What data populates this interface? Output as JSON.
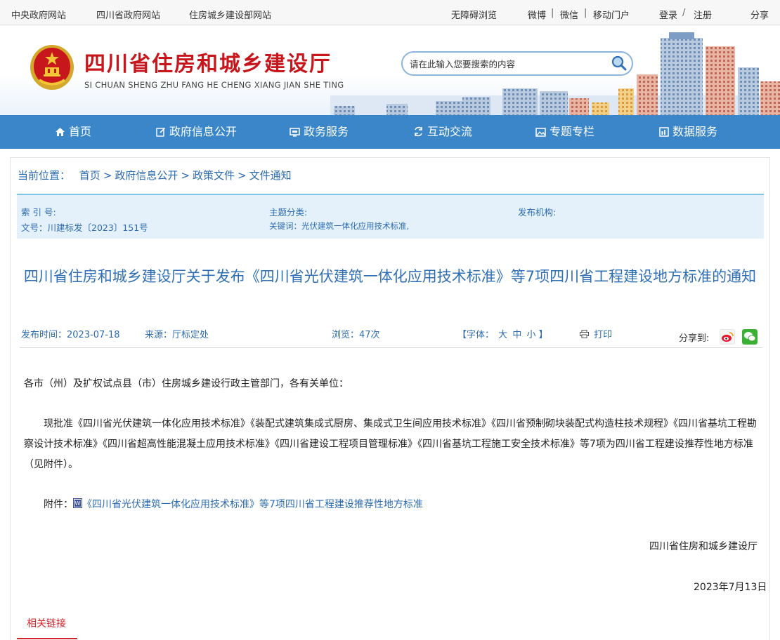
{
  "topbar": {
    "links_left": [
      "中央政府网站",
      "四川省政府网站",
      "住房城乡建设部网站"
    ],
    "accessibility": "无障碍浏览",
    "weibo": "微博",
    "wechat": "微信",
    "mobile": "移动门户",
    "login": "登录",
    "register": "注册",
    "share": "分享",
    "sep": "|",
    "slash": "/"
  },
  "header": {
    "title": "四川省住房和城乡建设厅",
    "subtitle": "SI CHUAN SHENG ZHU FANG HE CHENG XIANG JIAN SHE TING",
    "search_placeholder": "请在此输入您要搜索的内容"
  },
  "nav": {
    "items": [
      {
        "label": "首页",
        "icon": "home-icon"
      },
      {
        "label": "政府信息公开",
        "icon": "edit-icon"
      },
      {
        "label": "政务服务",
        "icon": "monitor-icon"
      },
      {
        "label": "互动交流",
        "icon": "exchange-icon"
      },
      {
        "label": "专题专栏",
        "icon": "picture-icon"
      },
      {
        "label": "数据服务",
        "icon": "chart-icon"
      }
    ]
  },
  "breadcrumb": {
    "prefix": "当前位置：",
    "items": [
      "首页",
      "政府信息公开",
      "政策文件",
      "文件通知"
    ],
    "sep": ">"
  },
  "meta": {
    "index_label": "索 引 号:",
    "doc_no": "文号：川建标发〔2023〕151号",
    "topic_label": "主题分类:",
    "keywords": "关键词：光伏建筑一体化应用技术标准,",
    "publisher_label": "发布机构:"
  },
  "article": {
    "title": "四川省住房和城乡建设厅关于发布《四川省光伏建筑一体化应用技术标准》等7项四川省工程建设地方标准的通知",
    "publish_time": "发布时间：2023-07-18",
    "source": "来源：厅标定处",
    "views": "浏览：47次",
    "font_label": "【字体：",
    "font_large": "大",
    "font_medium": "中",
    "font_small": "小",
    "font_end": "】",
    "print": "打印",
    "share_to": "分享到:",
    "greeting": "各市（州）及扩权试点县（市）住房城乡建设行政主管部门，各有关单位：",
    "paragraph": "现批准《四川省光伏建筑一体化应用技术标准》《装配式建筑集成式厨房、集成式卫生间应用技术标准》《四川省预制砌块装配式构造柱技术规程》《四川省基坑工程勘察设计技术标准》《四川省超高性能混凝土应用技术标准》《四川省建设工程项目管理标准》《四川省基坑工程施工安全技术标准》等7项为四川省工程建设推荐性地方标准（见附件）。",
    "attachment_label": "附件：",
    "attachment_link": "《四川省光伏建筑一体化应用技术标准》等7项四川省工程建设推荐性地方标准",
    "signature": "四川省住房和城乡建设厅",
    "date": "2023年7月13日"
  },
  "related": "相关链接",
  "colors": {
    "nav_bg": "#3a86c8",
    "title_red": "#c8161d",
    "link_blue": "#2c6bb0",
    "meta_bg": "#e4f1fb",
    "accent_red": "#d0262d"
  }
}
